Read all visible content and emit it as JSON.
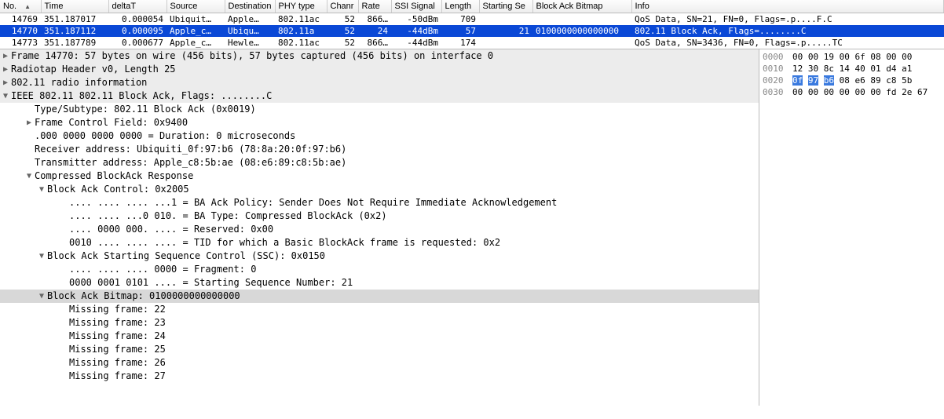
{
  "columns": {
    "no": "No.",
    "time": "Time",
    "deltaT": "deltaT",
    "source": "Source",
    "destination": "Destination",
    "phy": "PHY type",
    "chan": "Chanr",
    "rate": "Rate",
    "ssi": "SSI Signal",
    "length": "Length",
    "startseq": "Starting Se",
    "bitmap": "Block Ack Bitmap",
    "info": "Info"
  },
  "packets": [
    {
      "no": "14769",
      "time": "351.187017",
      "deltaT": "0.000054",
      "src": "Ubiquit…",
      "dst": "Apple…",
      "phy": "802.11ac",
      "chan": "52",
      "rate": "866…",
      "ssi": "-50dBm",
      "len": "709",
      "start": "",
      "bitmap": "",
      "info": "QoS Data, SN=21, FN=0, Flags=.p....F.C",
      "sel": false
    },
    {
      "no": "14770",
      "time": "351.187112",
      "deltaT": "0.000095",
      "src": "Apple_c…",
      "dst": "Ubiqu…",
      "phy": "802.11a",
      "chan": "52",
      "rate": "24",
      "ssi": "-44dBm",
      "len": "57",
      "start": "21",
      "bitmap": "0100000000000000",
      "info": "802.11 Block Ack, Flags=........C",
      "sel": true
    },
    {
      "no": "14773",
      "time": "351.187789",
      "deltaT": "0.000677",
      "src": "Apple_c…",
      "dst": "Hewle…",
      "phy": "802.11ac",
      "chan": "52",
      "rate": "866…",
      "ssi": "-44dBm",
      "len": "174",
      "start": "",
      "bitmap": "",
      "info": "QoS Data, SN=3436, FN=0, Flags=.p.....TC",
      "sel": false
    }
  ],
  "tree": [
    {
      "ind": 0,
      "tri": "closed",
      "top": true,
      "txt": "Frame 14770: 57 bytes on wire (456 bits), 57 bytes captured (456 bits) on interface 0"
    },
    {
      "ind": 0,
      "tri": "closed",
      "top": true,
      "txt": "Radiotap Header v0, Length 25"
    },
    {
      "ind": 0,
      "tri": "closed",
      "top": true,
      "txt": "802.11 radio information"
    },
    {
      "ind": 0,
      "tri": "open",
      "top": true,
      "txt": "IEEE 802.11 802.11 Block Ack, Flags: ........C"
    },
    {
      "ind": 1,
      "tri": "none",
      "txt": "Type/Subtype: 802.11 Block Ack (0x0019)"
    },
    {
      "ind": 1,
      "tri": "closed",
      "txt": "Frame Control Field: 0x9400"
    },
    {
      "ind": 1,
      "tri": "none",
      "txt": ".000 0000 0000 0000 = Duration: 0 microseconds"
    },
    {
      "ind": 1,
      "tri": "none",
      "txt": "Receiver address: Ubiquiti_0f:97:b6 (78:8a:20:0f:97:b6)"
    },
    {
      "ind": 1,
      "tri": "none",
      "txt": "Transmitter address: Apple_c8:5b:ae (08:e6:89:c8:5b:ae)"
    },
    {
      "ind": 1,
      "tri": "open",
      "txt": "Compressed BlockAck Response"
    },
    {
      "ind": 2,
      "tri": "open",
      "txt": "Block Ack Control: 0x2005"
    },
    {
      "ind": 3,
      "tri": "none",
      "txt": ".... .... .... ...1 = BA Ack Policy: Sender Does Not Require Immediate Acknowledgement"
    },
    {
      "ind": 3,
      "tri": "none",
      "txt": ".... .... ...0 010. = BA Type: Compressed BlockAck (0x2)"
    },
    {
      "ind": 3,
      "tri": "none",
      "txt": ".... 0000 000. .... = Reserved: 0x00"
    },
    {
      "ind": 3,
      "tri": "none",
      "txt": "0010 .... .... .... = TID for which a Basic BlockAck frame is requested: 0x2"
    },
    {
      "ind": 2,
      "tri": "open",
      "txt": "Block Ack Starting Sequence Control (SSC): 0x0150"
    },
    {
      "ind": 3,
      "tri": "none",
      "txt": ".... .... .... 0000 = Fragment: 0"
    },
    {
      "ind": 3,
      "tri": "none",
      "txt": "0000 0001 0101 .... = Starting Sequence Number: 21"
    },
    {
      "ind": 2,
      "tri": "open",
      "sel": true,
      "txt": "Block Ack Bitmap: 0100000000000000"
    },
    {
      "ind": 3,
      "tri": "none",
      "txt": "Missing frame: 22"
    },
    {
      "ind": 3,
      "tri": "none",
      "txt": "Missing frame: 23"
    },
    {
      "ind": 3,
      "tri": "none",
      "txt": "Missing frame: 24"
    },
    {
      "ind": 3,
      "tri": "none",
      "txt": "Missing frame: 25"
    },
    {
      "ind": 3,
      "tri": "none",
      "txt": "Missing frame: 26"
    },
    {
      "ind": 3,
      "tri": "none",
      "txt": "Missing frame: 27"
    }
  ],
  "hex": [
    {
      "offset": "0000",
      "bytes": [
        [
          "00",
          0
        ],
        [
          "00",
          0
        ],
        [
          "19",
          0
        ],
        [
          "00",
          0
        ],
        [
          "6f",
          0
        ],
        [
          "08",
          0
        ],
        [
          "00",
          0
        ],
        [
          "00",
          0
        ]
      ]
    },
    {
      "offset": "0010",
      "bytes": [
        [
          "12",
          0
        ],
        [
          "30",
          0
        ],
        [
          "8c",
          0
        ],
        [
          "14",
          0
        ],
        [
          "40",
          0
        ],
        [
          "01",
          0
        ],
        [
          "d4",
          0
        ],
        [
          "a1",
          0
        ]
      ]
    },
    {
      "offset": "0020",
      "bytes": [
        [
          "0f",
          1
        ],
        [
          "97",
          1
        ],
        [
          "b6",
          1
        ],
        [
          "08",
          0
        ],
        [
          "e6",
          0
        ],
        [
          "89",
          0
        ],
        [
          "c8",
          0
        ],
        [
          "5b",
          0
        ]
      ]
    },
    {
      "offset": "0030",
      "bytes": [
        [
          "00",
          0
        ],
        [
          "00",
          0
        ],
        [
          "00",
          0
        ],
        [
          "00",
          0
        ],
        [
          "00",
          0
        ],
        [
          "00",
          0
        ],
        [
          "fd",
          0
        ],
        [
          "2e",
          0
        ],
        [
          "67",
          0
        ]
      ]
    }
  ]
}
